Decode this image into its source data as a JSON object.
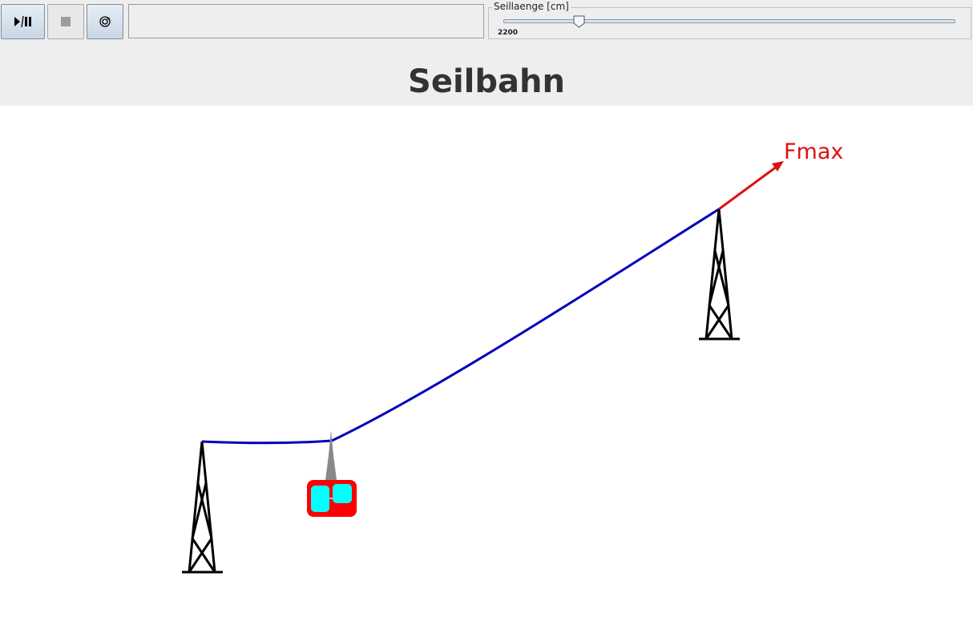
{
  "toolbar": {
    "play_pause_icon": "play-pause-icon",
    "stop_icon": "stop-icon",
    "reset_icon": "reset-icon",
    "status_text": ""
  },
  "slider": {
    "title": "Seillaenge [cm]",
    "value": "2200",
    "position_fraction": 0.167
  },
  "page": {
    "title": "Seilbahn"
  },
  "scene": {
    "force_label": "Fmax",
    "colors": {
      "cable": "#0000bb",
      "force_arrow": "#dd1111",
      "tower": "#000000",
      "gondola_body": "#ff0000",
      "gondola_windows": "#00ffff",
      "hanger": "#888888"
    }
  }
}
